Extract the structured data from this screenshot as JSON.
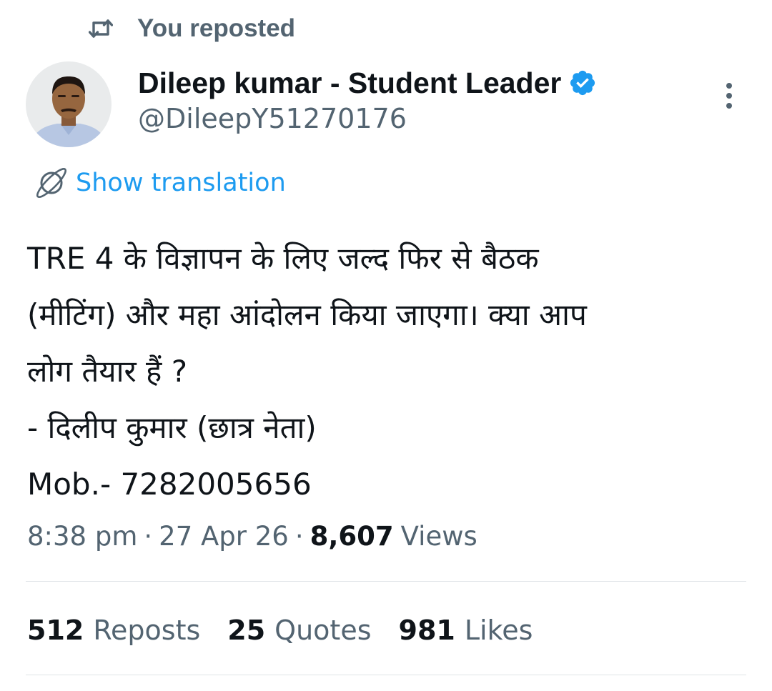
{
  "repost_context": {
    "icon": "repost-icon",
    "text": "You reposted"
  },
  "author": {
    "display_name": "Dileep kumar - Student Leader",
    "handle": "@DileepY51270176",
    "verified": true,
    "verified_color": "#1d9bf0",
    "avatar": "avatar-photo"
  },
  "translation": {
    "icon": "translate-globe-icon",
    "label": "Show translation",
    "color": "#1d9bf0"
  },
  "tweet": {
    "lines": [
      "TRE 4 के विज्ञापन के लिए जल्द फिर से बैठक",
      "(मीटिंग) और महा आंदोलन किया जाएगा। क्या आप",
      "लोग तैयार हैं ?",
      "- दिलीप कुमार (छात्र नेता)",
      "Mob.- 7282005656"
    ]
  },
  "meta": {
    "time": "8:38 pm",
    "separator": "·",
    "date": "27 Apr 26",
    "views_count": "8,607",
    "views_label": "Views"
  },
  "stats": {
    "reposts_count": "512",
    "reposts_label": "Reposts",
    "quotes_count": "25",
    "quotes_label": "Quotes",
    "likes_count": "981",
    "likes_label": "Likes"
  },
  "colors": {
    "text_primary": "#0f1419",
    "text_secondary": "#536471",
    "accent": "#1d9bf0",
    "divider": "#dfe3e7"
  }
}
